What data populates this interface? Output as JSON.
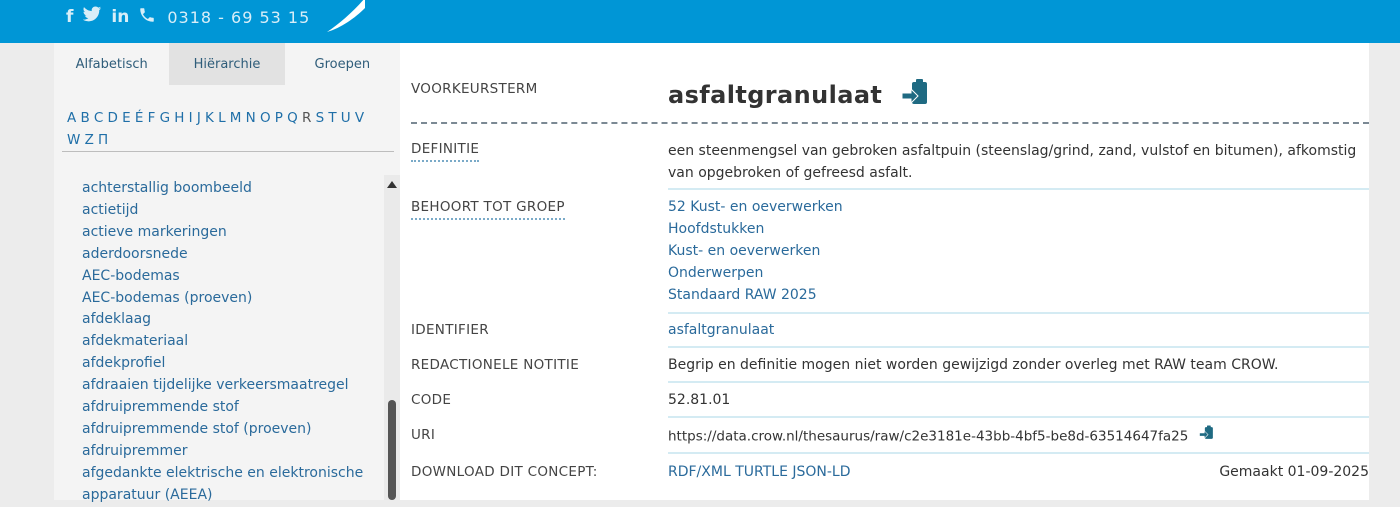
{
  "header": {
    "social_icons": [
      "facebook-icon",
      "twitter-icon",
      "linkedin-icon",
      "phone-icon"
    ],
    "facebook": "f",
    "linkedin": "in",
    "phone": "0318 - 69 53 15",
    "bar_color": "#0096d6"
  },
  "sidebar": {
    "tabs": [
      {
        "label": "Alfabetisch",
        "active": false
      },
      {
        "label": "Hiërarchie",
        "active": true
      },
      {
        "label": "Groepen",
        "active": false
      }
    ],
    "letters": [
      "A",
      "B",
      "C",
      "D",
      "E",
      "É",
      "F",
      "G",
      "H",
      "I",
      "J",
      "K",
      "L",
      "M",
      "N",
      "O",
      "P",
      "Q",
      "R",
      "S",
      "T",
      "U",
      "V",
      "W",
      "Z",
      "Π"
    ],
    "selected_letter": "R",
    "terms": [
      "achterstallig boombeeld",
      "actietijd",
      "actieve markeringen",
      "aderdoorsnede",
      "AEC-bodemas",
      "AEC-bodemas (proeven)",
      "afdeklaag",
      "afdekmateriaal",
      "afdekprofiel",
      "afdraaien tijdelijke verkeersmaatregel",
      "afdruipremmende stof",
      "afdruipremmende stof (proeven)",
      "afdruipremmer",
      "afgedankte elektrische en elektronische",
      "apparatuur (AEEA)"
    ]
  },
  "concept": {
    "pref_label_title": "VOORKEURSTERM",
    "pref_label": "asfaltgranulaat",
    "definition_title": "DEFINITIE",
    "definition_line1": "een steenmengsel van gebroken asfaltpuin (steenslag/grind, zand, vulstof en bitumen), afkomstig",
    "definition_line2": "van opgebroken of gefreesd asfalt.",
    "group_title": "BEHOORT TOT GROEP",
    "groups": [
      "52 Kust- en oeverwerken",
      "Hoofdstukken",
      "Kust- en oeverwerken",
      "Onderwerpen",
      "Standaard RAW 2025"
    ],
    "identifier_title": "IDENTIFIER",
    "identifier": "asfaltgranulaat",
    "note_title": "REDACTIONELE NOTITIE",
    "note": "Begrip en definitie mogen niet worden gewijzigd zonder overleg met RAW team CROW.",
    "code_title": "CODE",
    "code": "52.81.01",
    "uri_title": "URI",
    "uri": "https://data.crow.nl/thesaurus/raw/c2e3181e-43bb-4bf5-be8d-63514647fa25",
    "download_title": "DOWNLOAD DIT CONCEPT:",
    "downloads": [
      "RDF/XML",
      "TURTLE",
      "JSON-LD"
    ],
    "created": "Gemaakt 01-09-2025"
  }
}
